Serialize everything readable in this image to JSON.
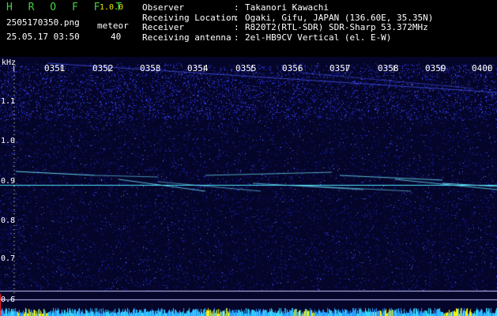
{
  "header": {
    "app_name": "H R O F F T",
    "version": "1.0.0",
    "filename": "2505170350.png",
    "datetime": "25.05.17 03:50",
    "meteor_label": "meteor",
    "meteor_count": "40"
  },
  "info": [
    {
      "key": "Observer",
      "sep": ":",
      "value": "Takanori Kawachi"
    },
    {
      "key": "Receiving Location",
      "sep": ":",
      "value": "Ogaki, Gifu, JAPAN (136.60E, 35.35N)"
    },
    {
      "key": "Receiver",
      "sep": ":",
      "value": "R820T2(RTL-SDR) SDR-Sharp 53.372MHz"
    },
    {
      "key": "Receiving antenna",
      "sep": ":",
      "value": "2el-HB9CV Vertical (el. E-W)"
    }
  ],
  "spectrogram": {
    "y_unit": "kHz",
    "time_labels": [
      "0351",
      "0352",
      "0353",
      "0354",
      "0355",
      "0356",
      "0357",
      "0358",
      "0359",
      "0400"
    ],
    "freq_labels": [
      "1.1",
      "1.0",
      "0.9",
      "0.8",
      "0.7",
      "0.6"
    ],
    "colors": {
      "background": "#05052a",
      "noise": "#1e2cff",
      "signal": "#6fe8ff",
      "grid": "#ffffff",
      "bar_yellow": "#f4f400",
      "bar_cyan": "#35d8ff"
    }
  }
}
